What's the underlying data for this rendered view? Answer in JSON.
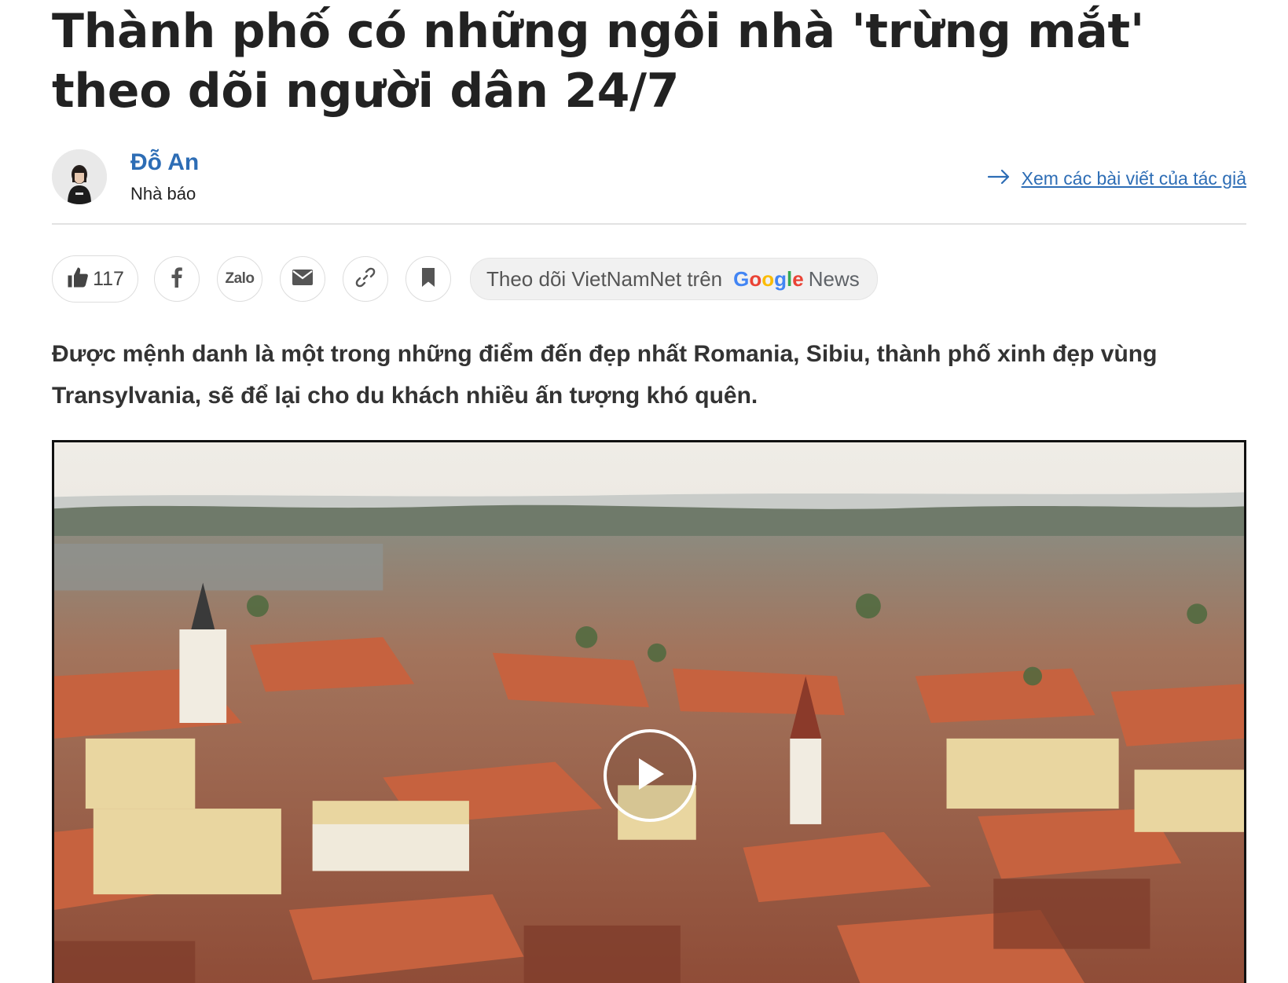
{
  "article": {
    "title": "Thành phố có những ngôi nhà 'trừng mắt' theo dõi người dân 24/7",
    "lead": "Được mệnh danh là một trong những điểm đến đẹp nhất Romania, Sibiu, thành phố xinh đẹp vùng Transylvania, sẽ để lại cho du khách nhiều ấn tượng khó quên."
  },
  "author": {
    "name": "Đỗ An",
    "role": "Nhà báo",
    "link_label": "Xem các bài viết của tác giả",
    "link_icon": "arrow-right-icon"
  },
  "share": {
    "like_count": "117",
    "like_icon": "thumbs-up-icon",
    "buttons": [
      {
        "name": "facebook",
        "icon": "facebook-icon"
      },
      {
        "name": "zalo",
        "label": "Zalo"
      },
      {
        "name": "email",
        "icon": "mail-icon"
      },
      {
        "name": "copy-link",
        "icon": "link-icon"
      },
      {
        "name": "bookmark",
        "icon": "bookmark-icon"
      }
    ],
    "follow_text": "Theo dõi VietNamNet trên",
    "google_word": "Google",
    "news_word": "News"
  },
  "colors": {
    "author_blue": "#2d6db5",
    "google_blue": "#4285F4",
    "google_red": "#EA4335",
    "google_yellow": "#FBBC05",
    "google_green": "#34A853",
    "roof_orange": "#c4603f"
  },
  "video": {
    "play_icon": "play-icon"
  }
}
